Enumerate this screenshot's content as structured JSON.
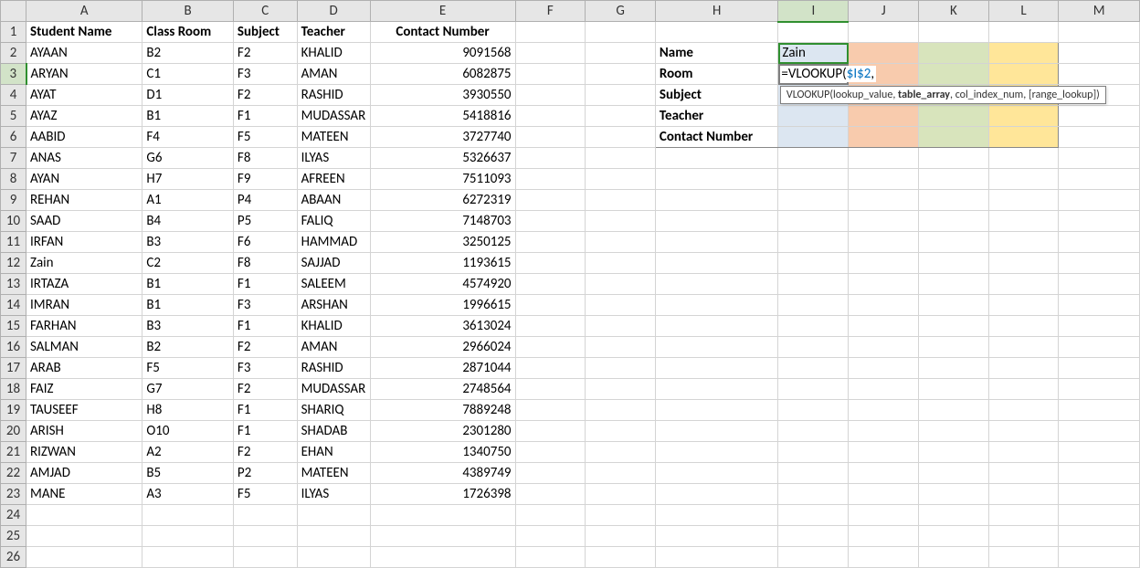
{
  "columns": [
    "A",
    "B",
    "C",
    "D",
    "E",
    "F",
    "G",
    "H",
    "I",
    "J",
    "K",
    "L",
    "M"
  ],
  "row_count": 26,
  "headers": {
    "A1": "Student Name",
    "B1": "Class Room",
    "C1": "Subject",
    "D1": "Teacher",
    "E1": "Contact Number"
  },
  "data": [
    {
      "name": "AYAAN",
      "room": "B2",
      "subject": "F2",
      "teacher": "KHALID",
      "contact": "9091568"
    },
    {
      "name": "ARYAN",
      "room": "C1",
      "subject": "F3",
      "teacher": "AMAN",
      "contact": "6082875"
    },
    {
      "name": "AYAT",
      "room": "D1",
      "subject": "F2",
      "teacher": "RASHID",
      "contact": "3930550"
    },
    {
      "name": "AYAZ",
      "room": "B1",
      "subject": "F1",
      "teacher": "MUDASSAR",
      "contact": "5418816"
    },
    {
      "name": "AABID",
      "room": "F4",
      "subject": "F5",
      "teacher": "MATEEN",
      "contact": "3727740"
    },
    {
      "name": "ANAS",
      "room": "G6",
      "subject": "F8",
      "teacher": "ILYAS",
      "contact": "5326637"
    },
    {
      "name": "AYAN",
      "room": "H7",
      "subject": "F9",
      "teacher": "AFREEN",
      "contact": "7511093"
    },
    {
      "name": "REHAN",
      "room": "A1",
      "subject": "P4",
      "teacher": "ABAAN",
      "contact": "6272319"
    },
    {
      "name": "SAAD",
      "room": "B4",
      "subject": "P5",
      "teacher": "FALIQ",
      "contact": "7148703"
    },
    {
      "name": "IRFAN",
      "room": "B3",
      "subject": "F6",
      "teacher": "HAMMAD",
      "contact": "3250125"
    },
    {
      "name": "Zain",
      "room": "C2",
      "subject": "F8",
      "teacher": "SAJJAD",
      "contact": "1193615"
    },
    {
      "name": "IRTAZA",
      "room": "B1",
      "subject": "F1",
      "teacher": "SALEEM",
      "contact": "4574920"
    },
    {
      "name": "IMRAN",
      "room": "B1",
      "subject": "F3",
      "teacher": "ARSHAN",
      "contact": "1996615"
    },
    {
      "name": "FARHAN",
      "room": "B3",
      "subject": "F1",
      "teacher": "KHALID",
      "contact": "3613024"
    },
    {
      "name": "SALMAN",
      "room": "B2",
      "subject": "F2",
      "teacher": "AMAN",
      "contact": "2966024"
    },
    {
      "name": "ARAB",
      "room": "F5",
      "subject": "F3",
      "teacher": "RASHID",
      "contact": "2871044"
    },
    {
      "name": "FAIZ",
      "room": "G7",
      "subject": "F2",
      "teacher": "MUDASSAR",
      "contact": "2748564"
    },
    {
      "name": "TAUSEEF",
      "room": "H8",
      "subject": "F1",
      "teacher": "SHARIQ",
      "contact": "7889248"
    },
    {
      "name": "ARISH",
      "room": "O10",
      "subject": "F1",
      "teacher": "SHADAB",
      "contact": "2301280"
    },
    {
      "name": "RIZWAN",
      "room": "A2",
      "subject": "F2",
      "teacher": "EHAN",
      "contact": "1340750"
    },
    {
      "name": "AMJAD",
      "room": "B5",
      "subject": "P2",
      "teacher": "MATEEN",
      "contact": "4389749"
    },
    {
      "name": "MANE",
      "room": "A3",
      "subject": "F5",
      "teacher": "ILYAS",
      "contact": "1726398"
    }
  ],
  "lookup": {
    "labels": {
      "name": "Name",
      "room": "Room",
      "subject": "Subject",
      "teacher": "Teacher",
      "contact": "Contact Number"
    },
    "I2": "Zain",
    "formula_prefix": "=VLOOKUP(",
    "formula_ref": "$I$2",
    "formula_suffix": ","
  },
  "tooltip": {
    "fn": "VLOOKUP(",
    "p1": "lookup_value",
    "p2": "table_array",
    "p3": "col_index_num",
    "p4": "[range_lookup]",
    "close": ")"
  }
}
